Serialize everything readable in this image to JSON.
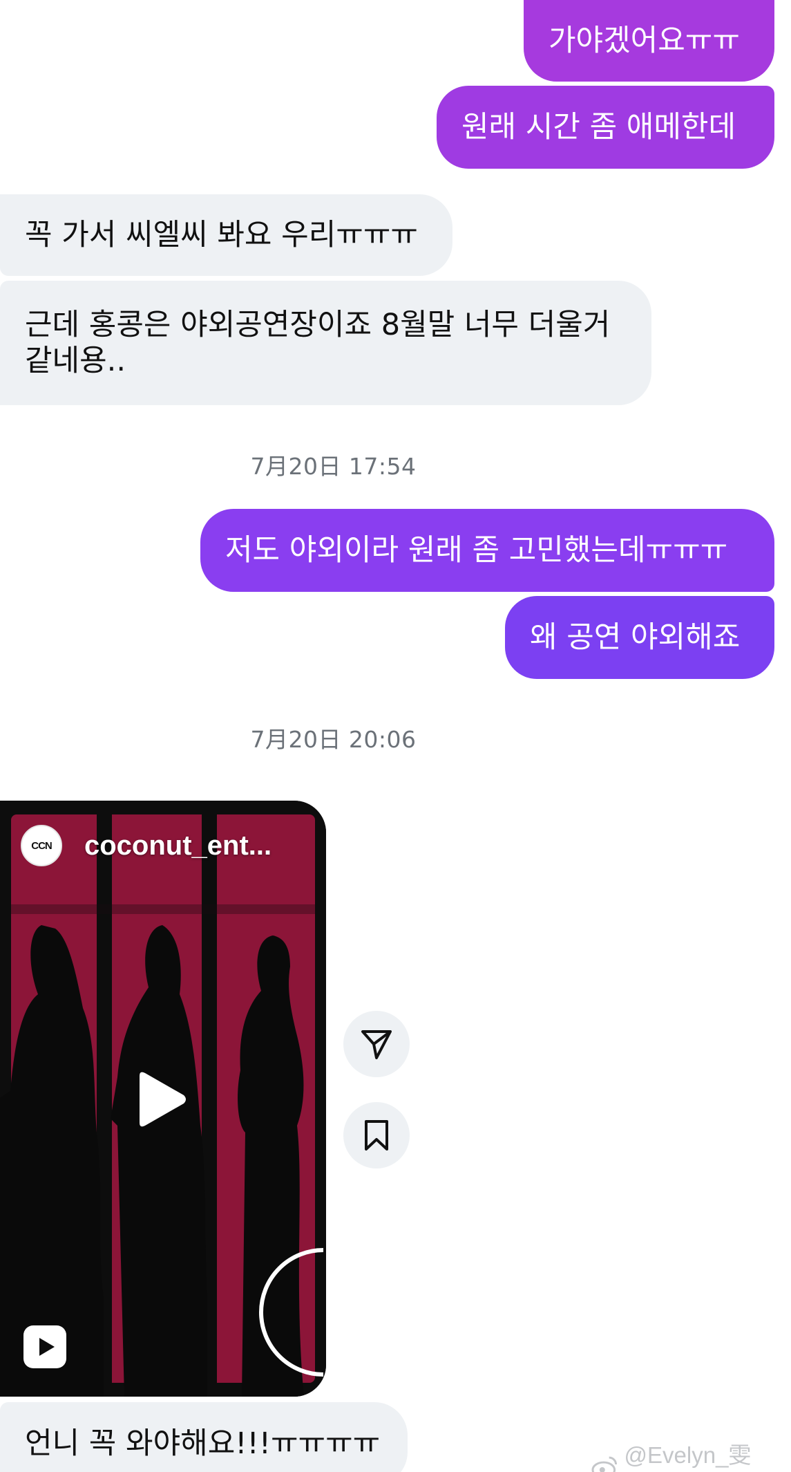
{
  "messages": [
    {
      "id": "m1",
      "side": "out",
      "text": "가야겠어요ㅠㅠ"
    },
    {
      "id": "m2",
      "side": "out",
      "text": "원래 시간 좀 애메한데"
    },
    {
      "id": "m3",
      "side": "in",
      "text": "꼭 가서 씨엘씨 봐요 우리ㅠㅠㅠ"
    },
    {
      "id": "m4",
      "side": "in",
      "line1": "근데 홍콩은 야외공연장이죠 8월말 너무 더울거",
      "line2": "같네용.."
    },
    {
      "id": "m5",
      "side": "out",
      "text": "저도 야외이라 원래 좀 고민했는데ㅠㅠㅠ"
    },
    {
      "id": "m6",
      "side": "out",
      "text": "왜 공연 야외해죠"
    },
    {
      "id": "m7",
      "side": "in",
      "text": "언니 꼭 와야해요!!!ㅠㅠㅠㅠ"
    }
  ],
  "timestamps": [
    "7月20日 17:54",
    "7月20日 20:06"
  ],
  "shared_reel": {
    "account": "coconut_ent...",
    "avatar_text": "CCN",
    "thumbnail": "silhouettes of three women behind dark bars on a crimson background",
    "actions": [
      "share-icon",
      "bookmark-icon"
    ]
  },
  "watermark": "@Evelyn_雯wen",
  "colors": {
    "outgoing_top": "#a43ae0",
    "outgoing_mid": "#8d3ef0",
    "outgoing_bottom": "#7b40f2",
    "incoming": "#eef1f4",
    "timestamp": "#6b7178",
    "reel_background": "#8c1538"
  }
}
